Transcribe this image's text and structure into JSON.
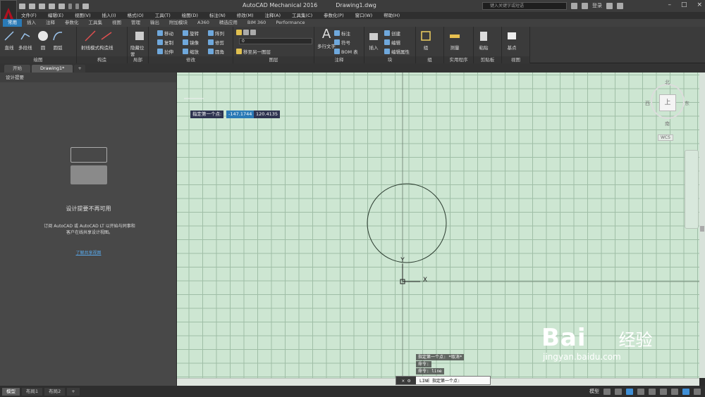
{
  "window": {
    "app_title": "AutoCAD Mechanical 2016",
    "doc_title": "Drawing1.dwg",
    "search_placeholder": "键入关键字或短语",
    "user_label": "登录"
  },
  "menu": [
    "文件(F)",
    "编辑(E)",
    "视图(V)",
    "插入(I)",
    "格式(O)",
    "工具(T)",
    "绘图(D)",
    "标注(N)",
    "修改(M)",
    "注释(A)",
    "工具集(C)",
    "参数化(P)",
    "窗口(W)",
    "帮助(H)"
  ],
  "ribbon_tabs": [
    "常用",
    "插入",
    "注释",
    "参数化",
    "工具集",
    "视图",
    "管理",
    "输出",
    "附加模块",
    "A360",
    "精选应用",
    "BIM 360",
    "Performance"
  ],
  "ribbon_active_tab": "常用",
  "ribbon": {
    "draw": {
      "title": "绘图",
      "tools": [
        "直线",
        "多段线",
        "圆",
        "圆弧"
      ]
    },
    "construct": {
      "title": "构造",
      "tools": [
        "射线模式",
        "构造线"
      ]
    },
    "detail": {
      "title": "局部",
      "tools": [
        "隐藏位置"
      ]
    },
    "modify": {
      "title": "修改",
      "rows": [
        "移动",
        "旋转",
        "阵列",
        "复制",
        "镜像",
        "修剪",
        "拉伸",
        "缩放",
        "圆角"
      ]
    },
    "layers": {
      "title": "图层",
      "current_layer": "0",
      "move_to": "移至另一图层"
    },
    "annotation": {
      "title": "注释",
      "text_tool": "多行文字",
      "rows": [
        "标注",
        "符号",
        "BOM 表"
      ]
    },
    "block": {
      "title": "块",
      "insert": "插入",
      "rows": [
        "创建",
        "编辑",
        "编辑属性"
      ]
    },
    "group": {
      "title": "组",
      "tool": "组"
    },
    "utilities": {
      "title": "实用程序",
      "tool": "测量"
    },
    "clipboard": {
      "title": "剪贴板",
      "tool": "粘贴"
    },
    "view": {
      "title": "视图",
      "tool": "基点"
    }
  },
  "doc_tabs": [
    "开始",
    "Drawing1*"
  ],
  "doc_tab_plus": "+",
  "left_panel": {
    "header": "设计提要",
    "title": "设计提要不再可用",
    "body": "订阅 AutoCAD 或 AutoCAD LT 以开始与同事和客户在线共享设计视图。",
    "link": "了解共享视图"
  },
  "canvas": {
    "prompt_label": "指定第一个点:",
    "x_value": "-147.1744",
    "y_value": "120.4135",
    "ucs_y_label": "Y",
    "ucs_x_label": "X",
    "grid_visible": true,
    "background_color": "#cde6d2"
  },
  "viewcube": {
    "north": "北",
    "south": "南",
    "west": "西",
    "east": "东",
    "face": "上",
    "wcs": "WCS"
  },
  "command": {
    "history": [
      "指定第一个点: *取消*",
      "命令:",
      "命令: line"
    ],
    "prompt": "LINE 指定第一个点:"
  },
  "layout_tabs": [
    "模型",
    "布局1",
    "布局2",
    "+"
  ],
  "status": {
    "model_label": "模型"
  },
  "watermark": {
    "brand": "Bai",
    "cn": "经验",
    "url": "jingyan.baidu.com"
  }
}
